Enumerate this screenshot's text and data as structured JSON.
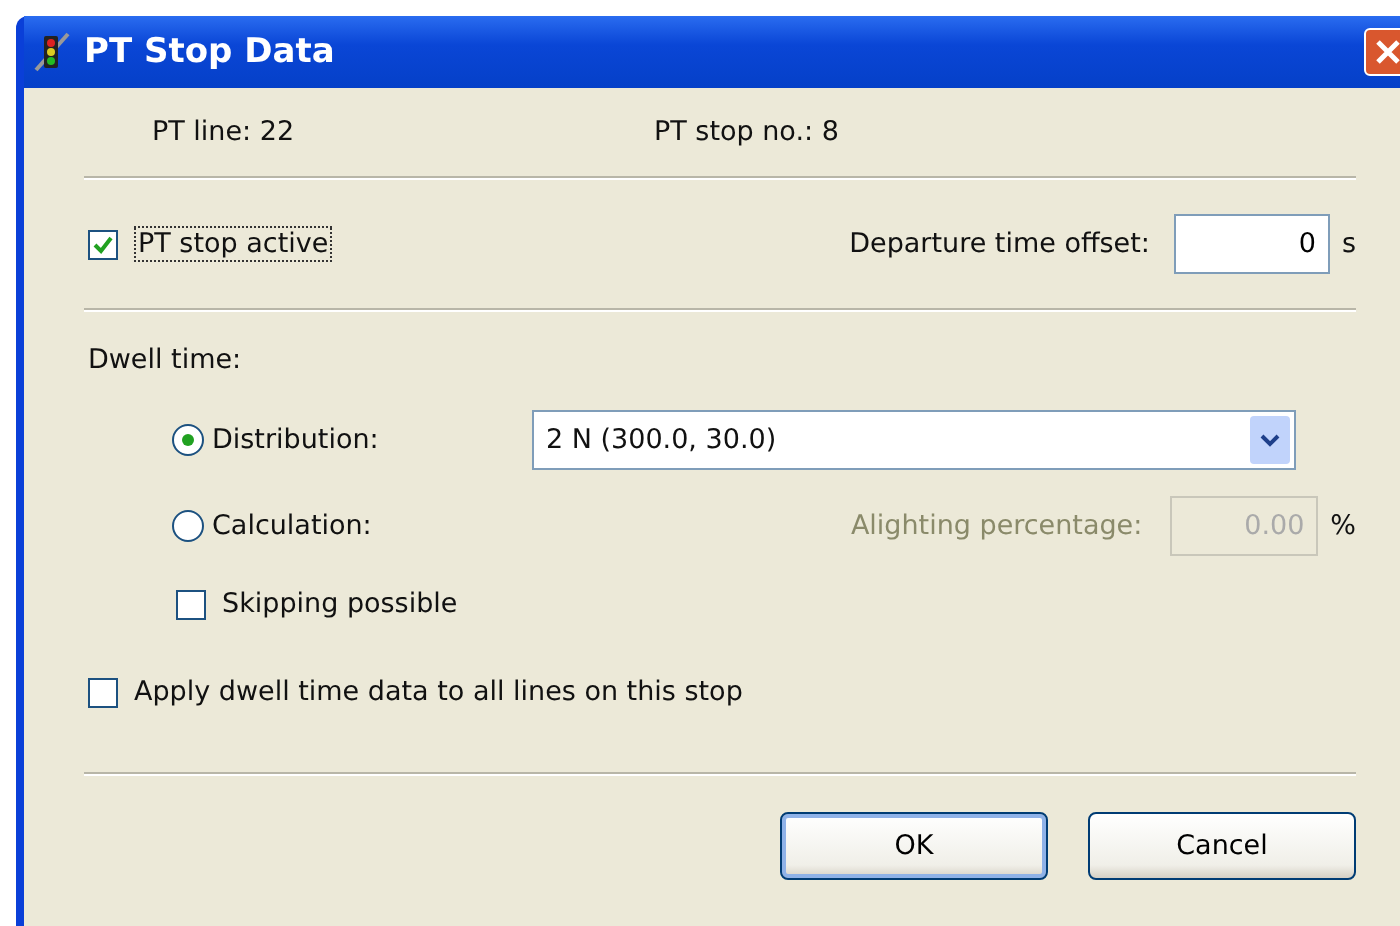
{
  "window": {
    "title": "PT Stop Data"
  },
  "info": {
    "line": "PT line: 22",
    "stop": "PT stop no.: 8"
  },
  "stop_active": {
    "label": "PT stop active",
    "checked": true
  },
  "departure_offset": {
    "label": "Departure time offset:",
    "value": "0",
    "unit": "s"
  },
  "dwell_time": {
    "label": "Dwell time:",
    "options": [
      {
        "label": "Distribution:",
        "selected": true
      },
      {
        "label": "Calculation:",
        "selected": false
      }
    ],
    "distribution": {
      "value": "2 N (300.0, 30.0)"
    },
    "alighting": {
      "label": "Alighting percentage:",
      "value": "0.00",
      "unit": "%",
      "disabled": true
    },
    "skipping": {
      "label": "Skipping possible",
      "checked": false
    }
  },
  "apply_all": {
    "label": "Apply dwell time data to all lines on this stop",
    "checked": false
  },
  "buttons": [
    {
      "label": "OK",
      "default": true
    },
    {
      "label": "Cancel",
      "default": false
    }
  ]
}
